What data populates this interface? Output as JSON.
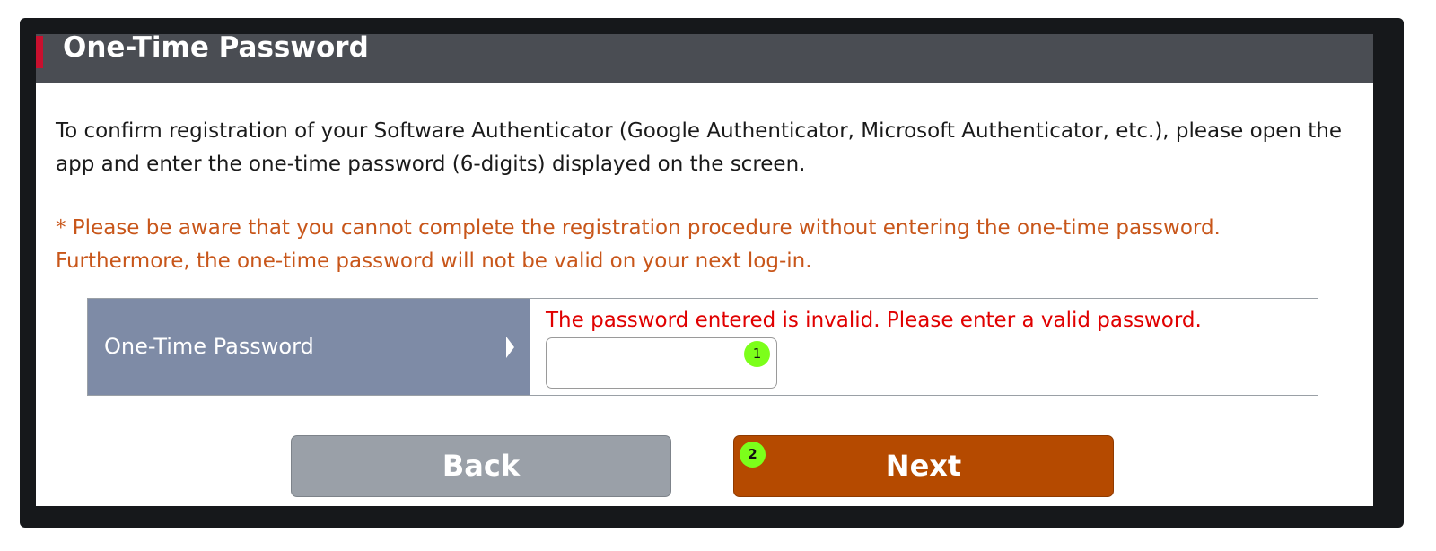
{
  "header": {
    "title": "One-Time Password",
    "accent_color": "#c8102e"
  },
  "content": {
    "intro": "To confirm registration of your Software Authenticator (Google Authenticator, Microsoft Authenticator, etc.), please open the app and enter the one-time password (6-digits) displayed on the screen.",
    "warning": "* Please be aware that you cannot complete the registration procedure without entering the one-time password. Furthermore, the one-time password will not be valid on your next log-in.",
    "warning_color": "#c8561a"
  },
  "form": {
    "label": "One-Time Password",
    "label_arrow_icon": "triangle-right-icon",
    "error": "The password entered is invalid. Please enter a valid password.",
    "error_color": "#e00000",
    "input_value": "",
    "input_placeholder": ""
  },
  "annotations": {
    "badge_1": "1",
    "badge_2": "2",
    "badge_color": "#7cff1a"
  },
  "buttons": {
    "back": "Back",
    "next": "Next",
    "next_color": "#b54a00",
    "back_color": "#9aa0a8"
  }
}
